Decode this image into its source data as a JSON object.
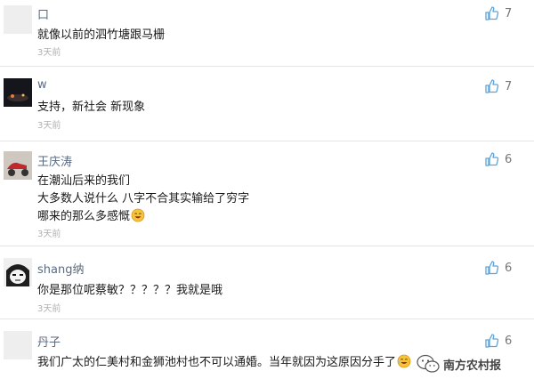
{
  "comments": [
    {
      "name": "口",
      "lines": [
        "就像以前的泗竹塘跟马栅"
      ],
      "time": "3天前",
      "likes": "7",
      "avatar": "blank-avatar"
    },
    {
      "name": "w",
      "lines": [
        "支持，新社会 新现象"
      ],
      "time": "3天前",
      "likes": "7",
      "avatar": "dark-night-avatar"
    },
    {
      "name": "王庆涛",
      "lines": [
        "在潮汕后来的我们",
        "大多数人说什么 八字不合其实输给了穷字",
        "哪来的那么多感慨"
      ],
      "time": "3天前",
      "likes": "6",
      "avatar": "red-scooter-avatar"
    },
    {
      "name": "shang纳",
      "lines": [
        "你是那位呢蔡敏？？？？？我就是哦"
      ],
      "time": "3天前",
      "likes": "6",
      "avatar": "cartoon-face-avatar"
    },
    {
      "name": "丹子",
      "lines": [
        "我们广太的仁美村和金狮池村也不可以通婚。当年就因为这原因分手了"
      ],
      "time": "3天前",
      "likes": "6",
      "avatar": "blank-avatar"
    }
  ],
  "watermark": {
    "text": "南方农村报",
    "icon": "wechat-logo"
  },
  "colors": {
    "name": "#5a6a80",
    "time": "#b0b0b0",
    "like_icon": "#5ea3d8",
    "divider": "#e4e4e4"
  }
}
